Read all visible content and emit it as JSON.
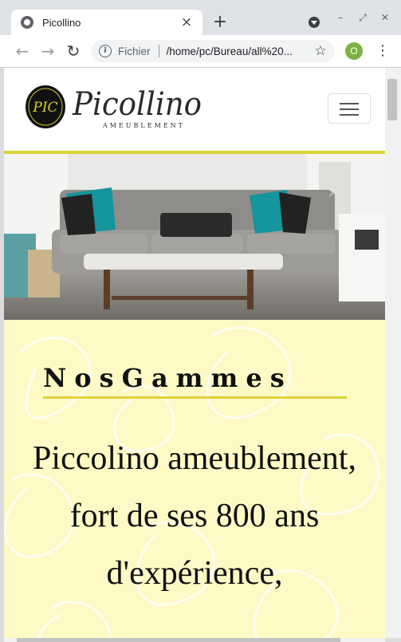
{
  "browser": {
    "tab_title": "Picollino",
    "tab_close": "×",
    "new_tab": "+",
    "scheme_label": "Fichier",
    "url": "/home/pc/Bureau/all%20...",
    "profile_initial": "O",
    "icons": [
      "back-arrow-icon",
      "forward-arrow-icon",
      "reload-icon",
      "info-icon",
      "star-icon",
      "kebab-menu-icon",
      "minimize-icon",
      "maximize-icon",
      "close-icon"
    ]
  },
  "page": {
    "logo_brand": "Picollino",
    "logo_tagline": "AMEUBLEMENT",
    "logo_emblem": "PIC",
    "gammes_title": "NosGammes",
    "gammes_text": "Piccolino ameublement, fort de ses 800 ans d'expérience,",
    "accent_color": "#ddd33a",
    "section_bg": "#fff9c5"
  }
}
